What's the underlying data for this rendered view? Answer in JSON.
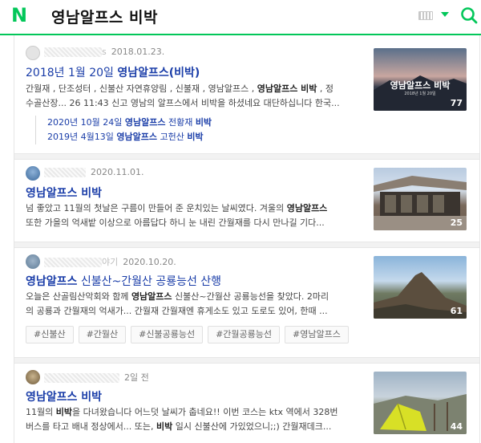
{
  "header": {
    "logo": "N",
    "query": "영남알프스 비박",
    "accent": "#03c75a"
  },
  "icons": {
    "keyboard": "keyboard-icon",
    "dropdown": "chevron-down-icon",
    "search": "search-icon"
  },
  "results": [
    {
      "author_suffix": "s",
      "date": "2018.01.23.",
      "title_pre": "2018년 1월 20일 ",
      "title_bold": "영남알프스(비박)",
      "snippet_line1_a": "간월재 , 단조성터 , 신불산 자연휴양림 , 신불재 , 영남알프스 , ",
      "snippet_line1_b": "영남알프스 비박",
      "snippet_line1_c": " , 정",
      "snippet_line2": "수골산장... 26 11:43 신고 영남의 알프스에서 비박을 하셨네요 대단하십니다 한국...",
      "subs": [
        {
          "pre": "2020년 10월 24일 ",
          "bold": "영남알프스",
          "mid": " 전황재 ",
          "bold2": "비박"
        },
        {
          "pre": "2019년 4월13일 ",
          "bold": "영남알프스",
          "mid": " 고헌산 ",
          "bold2": "비박"
        }
      ],
      "thumb_title": "영남알프스 비박",
      "thumb_sub": "2018년 1월 20일",
      "thumb_count": "77"
    },
    {
      "author_suffix": "",
      "date": "2020.11.01.",
      "title_pre": "",
      "title_bold": "영남알프스 비박",
      "snippet_line1_a": "넘 좋았고 11월의 첫날은 구름이 만들어 준 운치있는 날씨였다. 겨울의 ",
      "snippet_line1_b": "영남알프스",
      "snippet_line1_c": "",
      "snippet_line2": "또한 가을의 억새밭 이상으로 아름답다 하니 눈 내린 간월재를 다시 만나길 기다...",
      "thumb_count": "25"
    },
    {
      "author_suffix": "야기",
      "date": "2020.10.20.",
      "title_pre": "",
      "title_bold": "영남알프스",
      "title_post": " 신불산~간월산 공룡능선 산행",
      "snippet_line1_a": "오늘은 산골림산악회와 함께 ",
      "snippet_line1_b": "영남알프스",
      "snippet_line1_c": " 신불산~간월산 공룡능선을 찾았다. 2마리",
      "snippet_line2": "의 공룡과 간월재의 억새가... 간월재 간월재엔 휴게소도 있고 도로도 있어, 한때 ...",
      "tags": [
        "#신불산",
        "#간월산",
        "#신불공룡능선",
        "#간월공룡능선",
        "#영남알프스"
      ],
      "thumb_count": "61"
    },
    {
      "author_suffix": "",
      "date": "2일 전",
      "title_pre": "",
      "title_bold": "영남알프스 비박",
      "snippet_line1_a": "11월의 ",
      "snippet_line1_b": "비박",
      "snippet_line1_c": "을 다녀왔습니다 어느덧 날씨가 춥네요!! 이번 코스는 ktx 역에서 328번",
      "snippet_line2_a": "버스를 타고 배내 정상에서... 또는, ",
      "snippet_line2_b": "비박",
      "snippet_line2_c": " 일시 신불산에 가있었으니;;) 간월재데크...",
      "thumb_count": "44"
    }
  ]
}
